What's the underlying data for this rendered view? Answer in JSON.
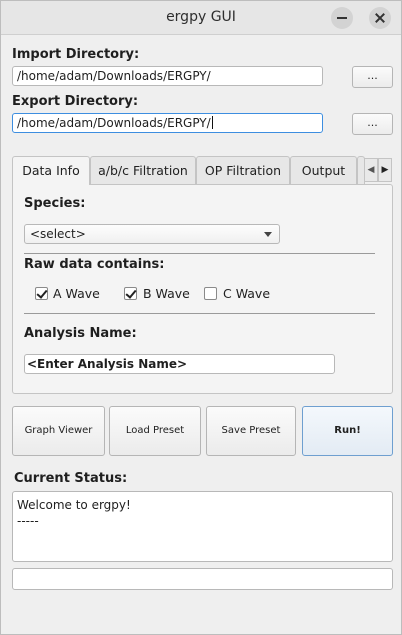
{
  "window": {
    "title": "ergpy GUI"
  },
  "import": {
    "label": "Import Directory:",
    "value": "/home/adam/Downloads/ERGPY/",
    "browse_label": "..."
  },
  "export": {
    "label": "Export Directory:",
    "value": "/home/adam/Downloads/ERGPY/",
    "browse_label": "..."
  },
  "tabs": [
    {
      "label": "Data Info"
    },
    {
      "label": "a/b/c Filtration"
    },
    {
      "label": "OP Filtration"
    },
    {
      "label": "Output"
    }
  ],
  "data_info": {
    "species_label": "Species:",
    "species_selected": "<select>",
    "raw_data_label": "Raw data contains:",
    "waves": [
      {
        "label": "A Wave",
        "checked": true
      },
      {
        "label": "B Wave",
        "checked": true
      },
      {
        "label": "C Wave",
        "checked": false
      }
    ],
    "analysis_name_label": "Analysis Name:",
    "analysis_name_value": "<Enter Analysis Name>"
  },
  "actions": {
    "graph_viewer": "Graph Viewer",
    "load_preset": "Load Preset",
    "save_preset": "Save Preset",
    "run": "Run!"
  },
  "status": {
    "label": "Current Status:",
    "line1": "Welcome to ergpy!",
    "line2": "-----"
  },
  "icons": {
    "minimize": "minimize-icon",
    "close": "close-icon",
    "tab_left": "chevron-left-icon",
    "tab_right": "chevron-right-icon",
    "dropdown": "chevron-down-icon"
  },
  "colors": {
    "focus_border": "#3d8ee0",
    "primary_border": "#6e9fd0"
  }
}
